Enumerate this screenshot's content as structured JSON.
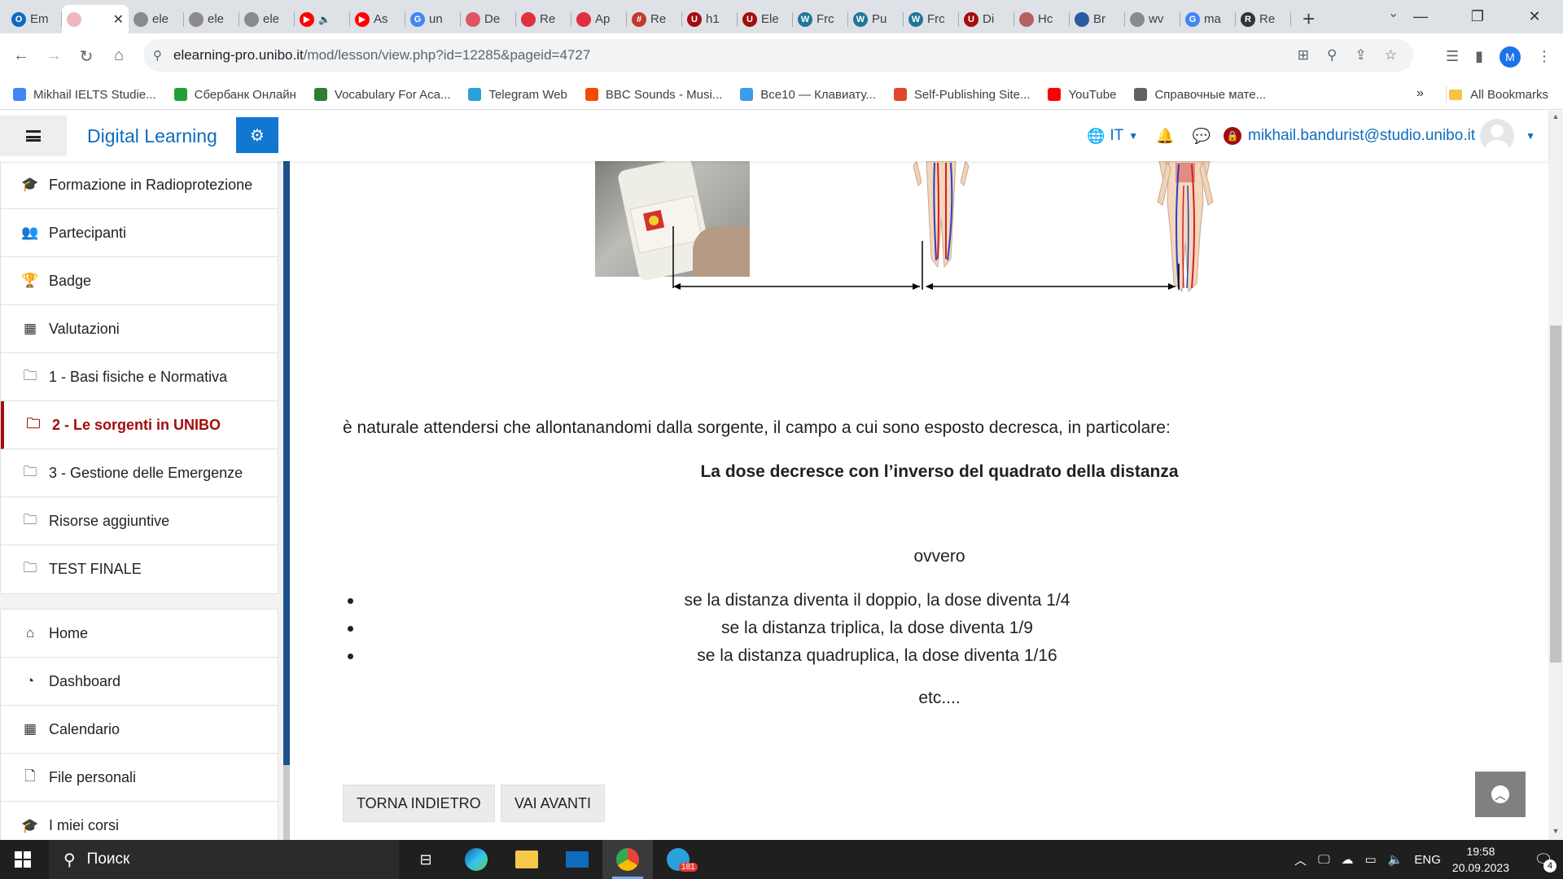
{
  "browser": {
    "tabs": [
      {
        "label": "Em",
        "color": "#0f6cbd",
        "glyph": "O"
      },
      {
        "label": "",
        "color": "#f1b6c0",
        "glyph": "",
        "active": true
      },
      {
        "label": "ele",
        "color": "#8a8a8a",
        "glyph": ""
      },
      {
        "label": "ele",
        "color": "#8a8a8a",
        "glyph": ""
      },
      {
        "label": "ele",
        "color": "#8a8a8a",
        "glyph": ""
      },
      {
        "label": "",
        "color": "#ff0000",
        "glyph": "▶",
        "muted": true
      },
      {
        "label": "As",
        "color": "#ff0000",
        "glyph": "▶"
      },
      {
        "label": "un",
        "color": "#4285f4",
        "glyph": "G"
      },
      {
        "label": "De",
        "color": "#e05565",
        "glyph": ""
      },
      {
        "label": "Re",
        "color": "#e03040",
        "glyph": ""
      },
      {
        "label": "Ap",
        "color": "#e03040",
        "glyph": ""
      },
      {
        "label": "Re",
        "color": "#c0392b",
        "glyph": "#"
      },
      {
        "label": "h1",
        "color": "#a40c0c",
        "glyph": "U"
      },
      {
        "label": "Ele",
        "color": "#a40c0c",
        "glyph": "U"
      },
      {
        "label": "Frc",
        "color": "#21759b",
        "glyph": "W"
      },
      {
        "label": "Pu",
        "color": "#21759b",
        "glyph": "W"
      },
      {
        "label": "Frc",
        "color": "#21759b",
        "glyph": "W"
      },
      {
        "label": "Di",
        "color": "#a40c0c",
        "glyph": "U"
      },
      {
        "label": "Hc",
        "color": "#b46060",
        "glyph": ""
      },
      {
        "label": "Br",
        "color": "#2a5aa0",
        "glyph": ""
      },
      {
        "label": "wv",
        "color": "#8a8a8a",
        "glyph": ""
      },
      {
        "label": "ma",
        "color": "#4285f4",
        "glyph": "G"
      },
      {
        "label": "Re",
        "color": "#333333",
        "glyph": "R"
      }
    ],
    "new_tab_symbol": "+",
    "url_host": "elearning-pro.unibo.it",
    "url_path": "/mod/lesson/view.php?id=12285&pageid=4727",
    "profile_initial": "M",
    "bookmarks": [
      {
        "label": "Mikhail IELTS Studie...",
        "color": "#4285f4"
      },
      {
        "label": "Сбербанк Онлайн",
        "color": "#21a038"
      },
      {
        "label": "Vocabulary For Aca...",
        "color": "#2e7d32"
      },
      {
        "label": "Telegram Web",
        "color": "#2aa1da"
      },
      {
        "label": "BBC Sounds - Musi...",
        "color": "#f54b00"
      },
      {
        "label": "Все10 — Клавиату...",
        "color": "#3d9be9"
      },
      {
        "label": "Self-Publishing Site...",
        "color": "#e2462c"
      },
      {
        "label": "YouTube",
        "color": "#ff0000"
      },
      {
        "label": "Справочные мате...",
        "color": "#5f6368"
      }
    ],
    "bookmarks_more": "»",
    "all_bookmarks": "All Bookmarks"
  },
  "moodle": {
    "site_name": "Digital Learning",
    "lang": "IT",
    "user_email": "mikhail.bandurist@studio.unibo.it"
  },
  "drawer": {
    "course_items": [
      {
        "label": "Formazione in Radioprotezione",
        "icon": "graduation-cap-icon",
        "glyph": "🎓"
      },
      {
        "label": "Partecipanti",
        "icon": "users-icon",
        "glyph": "👥"
      },
      {
        "label": "Badge",
        "icon": "trophy-icon",
        "glyph": "🏆"
      },
      {
        "label": "Valutazioni",
        "icon": "table-icon",
        "glyph": "▦"
      },
      {
        "label": "1 - Basi fisiche e Normativa",
        "icon": "folder-icon",
        "glyph": "🗀"
      },
      {
        "label": "2 - Le sorgenti in UNIBO",
        "icon": "folder-icon",
        "glyph": "🗀",
        "active": true
      },
      {
        "label": "3 - Gestione delle Emergenze",
        "icon": "folder-icon",
        "glyph": "🗀"
      },
      {
        "label": "Risorse aggiuntive",
        "icon": "folder-icon",
        "glyph": "🗀"
      },
      {
        "label": "TEST FINALE",
        "icon": "folder-icon",
        "glyph": "🗀"
      }
    ],
    "site_items": [
      {
        "label": "Home",
        "icon": "home-icon",
        "glyph": "⌂"
      },
      {
        "label": "Dashboard",
        "icon": "dashboard-icon",
        "glyph": "◔"
      },
      {
        "label": "Calendario",
        "icon": "calendar-icon",
        "glyph": "▦"
      },
      {
        "label": "File personali",
        "icon": "file-icon",
        "glyph": "🗋"
      },
      {
        "label": "I miei corsi",
        "icon": "graduation-cap-icon",
        "glyph": "🎓"
      }
    ]
  },
  "content": {
    "paragraph": "è naturale attendersi che allontanandomi dalla sorgente, il campo a cui sono esposto decresca, in particolare:",
    "rule": "La dose decresce con l’inverso del quadrato della distanza",
    "ovvero": "ovvero",
    "bullets": [
      "se la distanza diventa il doppio, la dose diventa 1/4",
      "se la distanza triplica, la dose diventa 1/9",
      "se la distanza quadruplica, la dose diventa 1/16"
    ],
    "etc": "etc....",
    "back_button": "TORNA INDIETRO",
    "next_button": "VAI AVANTI"
  },
  "taskbar": {
    "search_placeholder": "Поиск",
    "language": "ENG",
    "time": "19:58",
    "date": "20.09.2023",
    "telegram_badge": "181",
    "notifications_count": "4"
  }
}
